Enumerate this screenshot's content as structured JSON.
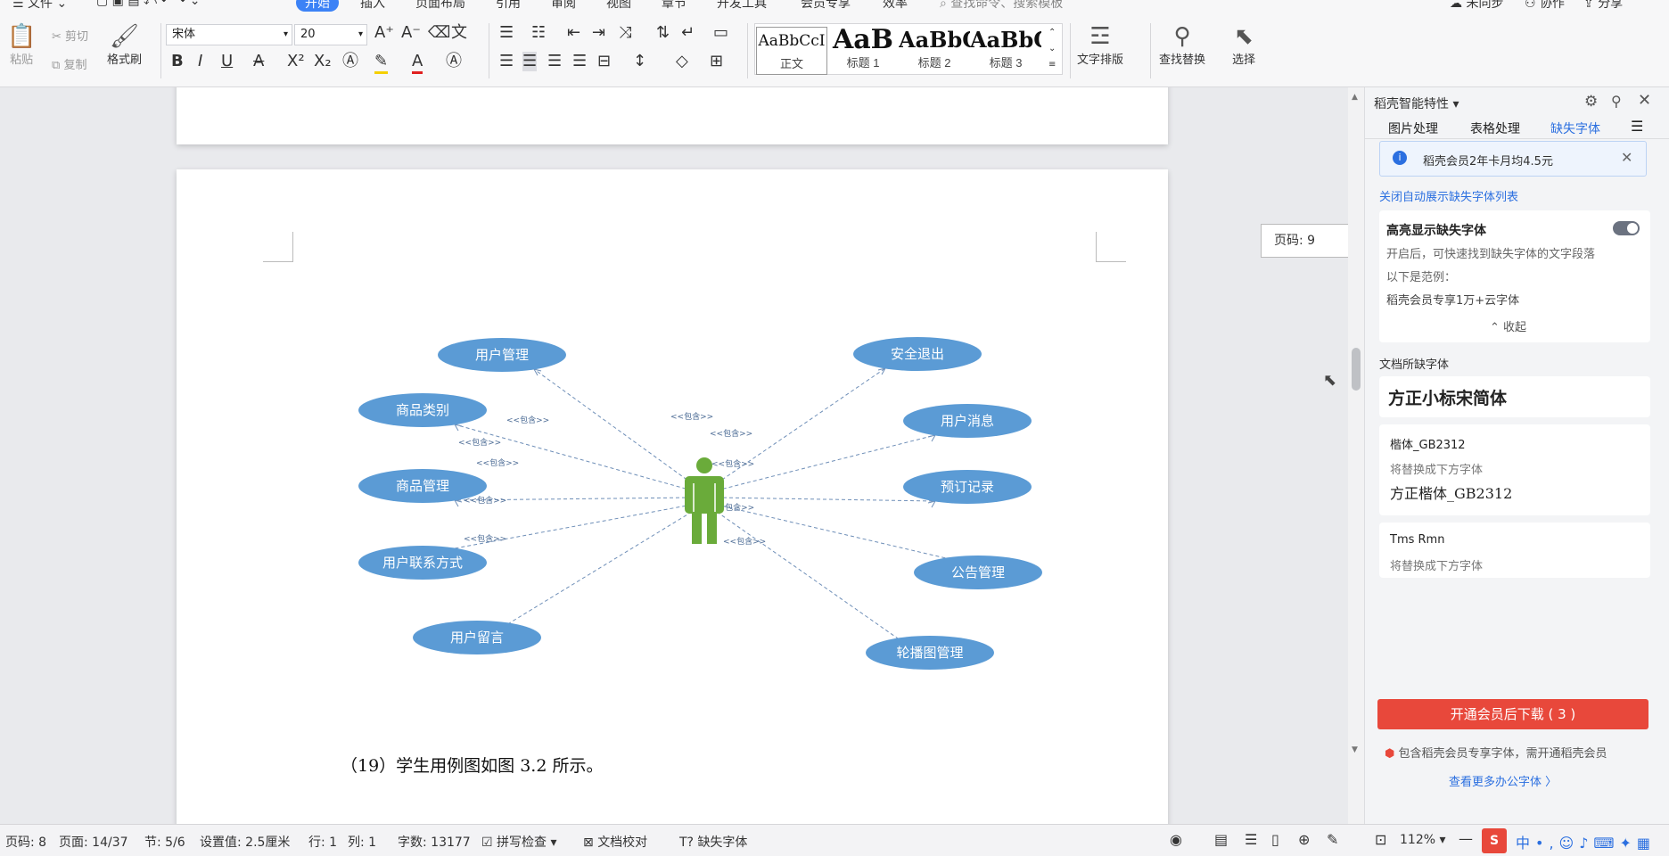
{
  "menu": {
    "file": "文件",
    "tabs": [
      "开始",
      "插入",
      "页面布局",
      "引用",
      "审阅",
      "视图",
      "章节",
      "开发工具",
      "会员专享",
      "效率"
    ],
    "search": "查找命令、搜索模板",
    "right": [
      "未同步",
      "协作",
      "分享"
    ]
  },
  "toolbar": {
    "paste": "粘贴",
    "cut": "剪切",
    "copy": "复制",
    "format_painter": "格式刷",
    "font_name": "宋体",
    "font_size": "20",
    "find_replace": "查找替换",
    "select": "选择",
    "text_layout": "文字排版",
    "styles": [
      {
        "sample": "AaBbCcI",
        "name": "正文"
      },
      {
        "sample": "AaB",
        "name": "标题 1"
      },
      {
        "sample": "AaBbC",
        "name": "标题 2"
      },
      {
        "sample": "AaBbC",
        "name": "标题 3"
      }
    ]
  },
  "diagram": {
    "actor_color": "#6aab3a",
    "ellipse_color": "#5b9bd5",
    "include_label": "<<包含>>",
    "left": [
      "用户管理",
      "商品类别",
      "商品管理",
      "用户联系方式",
      "用户留言"
    ],
    "right": [
      "安全退出",
      "用户消息",
      "预订记录",
      "公告管理",
      "轮播图管理"
    ]
  },
  "document": {
    "caption": "（19）学生用例图如图 3.2 所示。",
    "page_badge": "页码: 9"
  },
  "panel": {
    "title": "稻壳智能特性",
    "tabs": [
      "图片处理",
      "表格处理",
      "缺失字体"
    ],
    "active_tab": "缺失字体",
    "promo": "稻壳会员2年卡月均4.5元",
    "close_auto": "关闭自动展示缺失字体列表",
    "highlight_title": "高亮显示缺失字体",
    "highlight_desc": "开启后，可快速找到缺失字体的文字段落",
    "example_label": "以下是范例：",
    "example_text": "稻壳会员专享1万+云字体",
    "collapse": "收起",
    "doc_fonts_label": "文档所缺字体",
    "font1": "方正小标宋简体",
    "font2": "楷体_GB2312",
    "replace_label": "将替换成下方字体",
    "font2_replacement": "方正楷体_GB2312",
    "font3": "Tms Rmn",
    "download_button": "开通会员后下载 ( 3 )",
    "notice": "包含稻壳会员专享字体，需开通稻壳会员",
    "more_fonts": "查看更多办公字体 〉",
    "accent": "#e8483b"
  },
  "status": {
    "page_no": "页码: 8",
    "pages": "页面: 14/37",
    "section": "节: 5/6",
    "setting": "设置值: 2.5厘米",
    "row": "行: 1",
    "col": "列: 1",
    "words": "字数: 13177",
    "spell": "拼写检查",
    "proof": "文档校对",
    "missing": "缺失字体",
    "zoom": "112%"
  }
}
